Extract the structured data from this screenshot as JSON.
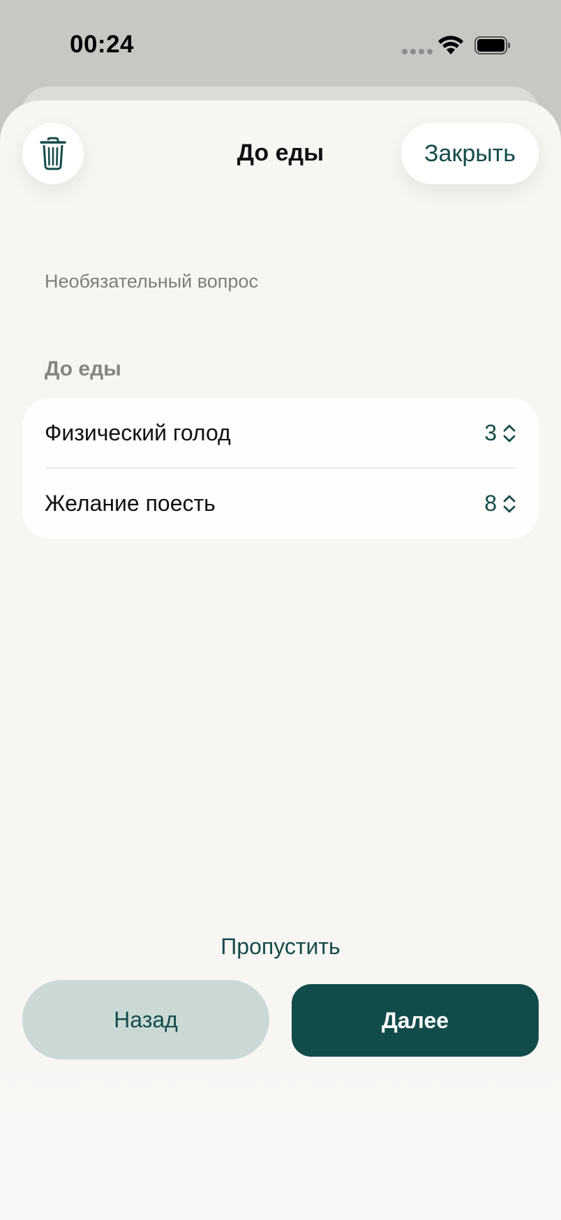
{
  "status_bar": {
    "time": "00:24"
  },
  "header": {
    "title": "До еды",
    "close_label": "Закрыть"
  },
  "content": {
    "optional_label": "Необязательный вопрос",
    "section_header": "До еды",
    "rows": [
      {
        "label": "Физический голод",
        "value": "3"
      },
      {
        "label": "Желание поесть",
        "value": "8"
      }
    ]
  },
  "footer": {
    "skip_label": "Пропустить",
    "back_label": "Назад",
    "next_label": "Далее"
  },
  "colors": {
    "accent": "#134b4a",
    "primary_button": "#114c4b",
    "secondary_button": "#cbd9d6",
    "sheet_bg": "#f7f6f2"
  },
  "icons": [
    "trash-icon",
    "chevron-up-down-icon",
    "wifi-icon",
    "battery-icon",
    "cellular-signal-icon"
  ]
}
